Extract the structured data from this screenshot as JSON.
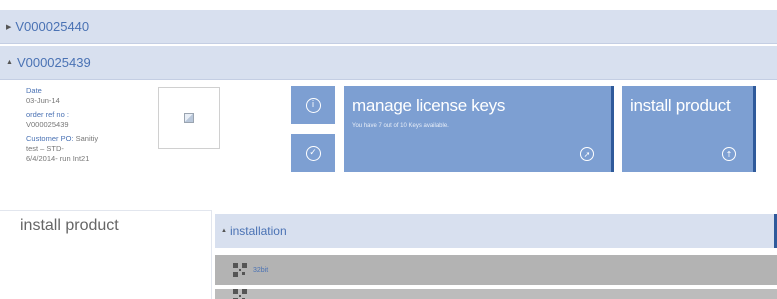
{
  "orders": [
    {
      "id": "V000025440",
      "expanded": false
    },
    {
      "id": "V000025439",
      "expanded": true
    }
  ],
  "order_detail": {
    "date_label": "Date",
    "date_value": "03-Jun-14",
    "order_ref_label": "order ref no :",
    "order_ref_value": "V000025439",
    "customer_po_label": "Customer PO:",
    "customer_po_value_1": "Sanitiy",
    "customer_po_value_2": "test – STD-",
    "customer_po_value_3": "6/4/2014- run Int21"
  },
  "tiles": {
    "license": {
      "title": "manage license keys",
      "subtitle": "You have 7 out of 10 Keys available."
    },
    "install": {
      "title": "install product"
    }
  },
  "install_panel": {
    "heading": "install product",
    "section_label": "installation",
    "rows": [
      {
        "label": "32bit"
      },
      {
        "label": ""
      }
    ]
  },
  "colors": {
    "tile_blue": "#7d9fd2",
    "bar_blue": "#d8e0ef",
    "accent_dark": "#2f5a9b",
    "link_blue": "#4a72b4"
  }
}
